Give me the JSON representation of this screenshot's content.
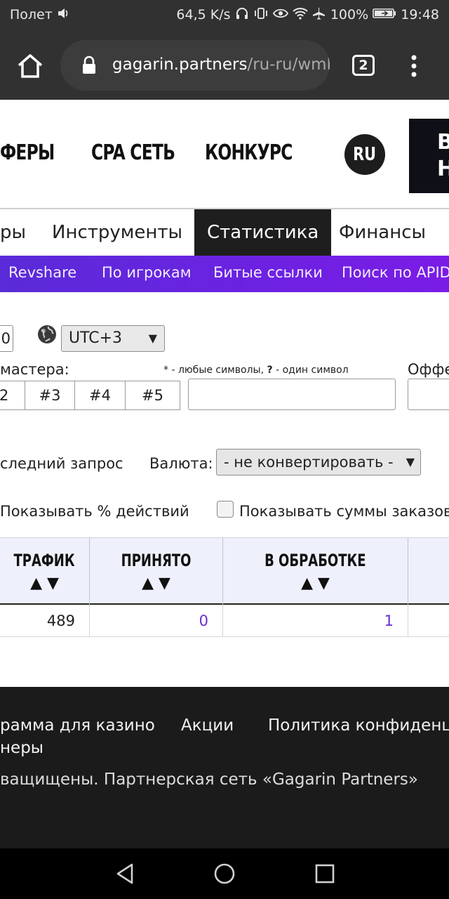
{
  "status_bar": {
    "carrier": "Полет",
    "speed": "64,5 K/s",
    "battery": "100%",
    "time": "19:48"
  },
  "browser": {
    "url_host": "gagarin.partners",
    "url_path": "/ru-ru/wmN",
    "tab_count": "2"
  },
  "top_nav": {
    "items": [
      "ФЕРЫ",
      "CPA СЕТЬ",
      "КОНКУРС"
    ],
    "lang": "RU",
    "promo_text": [
      "В",
      "Н"
    ]
  },
  "tabs": [
    "ры",
    "Инструменты",
    "Статистика",
    "Финансы"
  ],
  "subnav": [
    "Revshare",
    "По игрокам",
    "Битые ссылки",
    "Поиск по APID"
  ],
  "form": {
    "partial_input": "0",
    "timezone": "UTC+3",
    "webmaster_label": "мастера:",
    "wildcard_hint_prefix": "* - любые символы, ",
    "wildcard_hint_bold": "?",
    "wildcard_hint_suffix": " - один символ",
    "offer_label": "Оффе",
    "sub_tabs": [
      "2",
      "#3",
      "#4",
      "#5"
    ],
    "last_request_label": "следний запрос",
    "currency_label": "Валюта:",
    "currency_value": "- не конвертировать -",
    "show_percent_label": "Показывать % действий",
    "show_sums_label": "Показывать суммы заказов"
  },
  "table": {
    "columns": [
      {
        "title": "ТРАФИК",
        "sort": "▲ ▼"
      },
      {
        "title": "ПРИНЯТО",
        "sort": "▲ ▼"
      },
      {
        "title": "В ОБРАБОТКЕ",
        "sort": "▲ ▼"
      }
    ],
    "rows": [
      [
        "489",
        "0",
        "1"
      ]
    ],
    "link_color": "#6a2bd1"
  },
  "footer": {
    "links": [
      "рамма для казино",
      "Акции",
      "Политика конфиденц"
    ],
    "link_line2": "неры",
    "copyright": "ващищены. Партнерская сеть «Gagarin Partners»"
  },
  "colors": {
    "subnav_accent": "#6a23e0",
    "dark_bg": "#1b1b1b"
  }
}
